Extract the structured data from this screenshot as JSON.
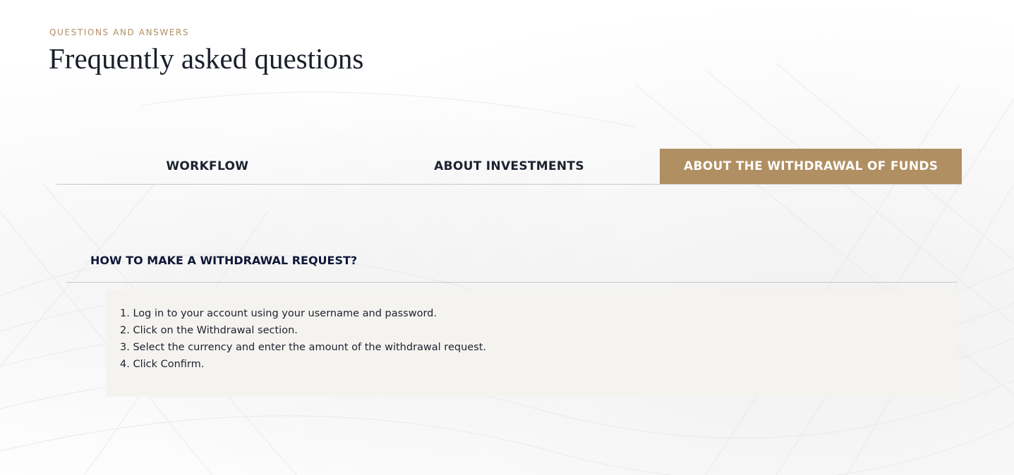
{
  "header": {
    "eyebrow": "QUESTIONS AND ANSWERS",
    "title": "Frequently asked questions"
  },
  "tabs": [
    {
      "label": "WORKFLOW",
      "active": false
    },
    {
      "label": "ABOUT INVESTMENTS",
      "active": false
    },
    {
      "label": "ABOUT THE WITHDRAWAL OF FUNDS",
      "active": true
    }
  ],
  "faq": {
    "question": "HOW TO MAKE A WITHDRAWAL REQUEST?",
    "answer_steps": [
      "1. Log in to your account using your username and password.",
      "2. Click on the Withdrawal section.",
      "3. Select the currency and enter the amount of the withdrawal request.",
      "4. Click Confirm."
    ]
  },
  "colors": {
    "accent": "#b08f62",
    "text_dark": "#1c2130",
    "question_text": "#0e1738",
    "answer_bg": "#f5f3ef"
  }
}
